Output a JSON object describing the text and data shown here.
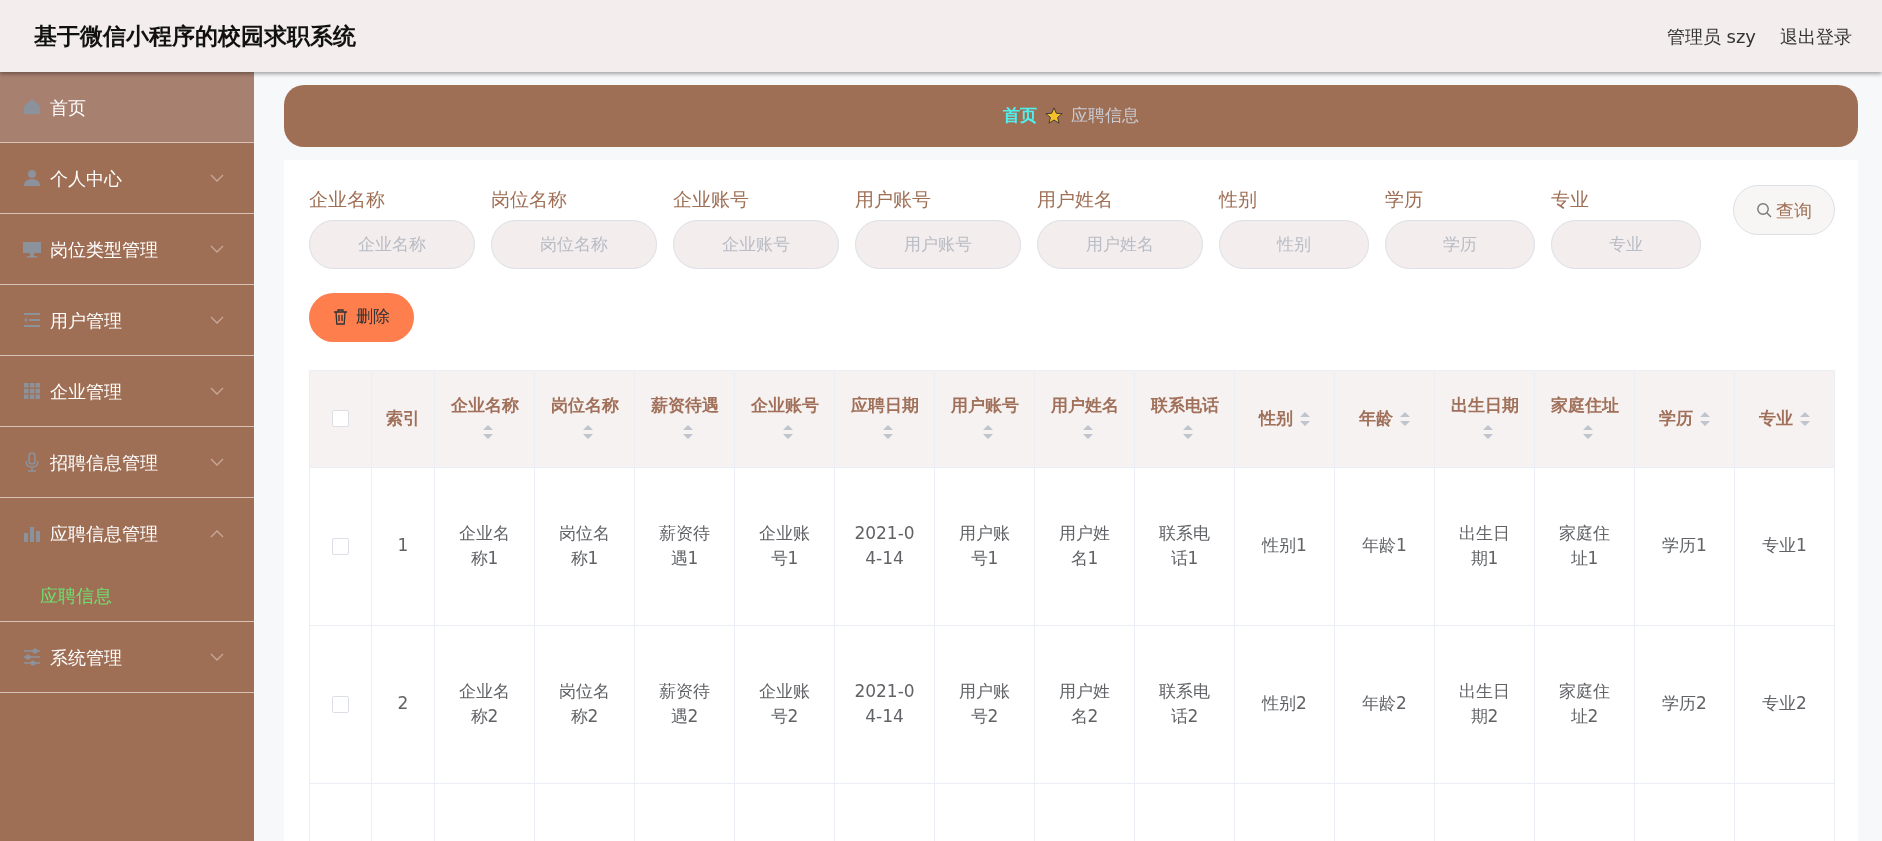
{
  "header": {
    "title": "基于微信小程序的校园求职系统",
    "user": "管理员 szy",
    "logout": "退出登录"
  },
  "sidebar": {
    "items": [
      {
        "label": "首页",
        "kind": "link",
        "selected": true
      },
      {
        "label": "个人中心",
        "kind": "menu",
        "selected": false,
        "expanded": false
      },
      {
        "label": "岗位类型管理",
        "kind": "menu",
        "selected": false,
        "expanded": false
      },
      {
        "label": "用户管理",
        "kind": "menu",
        "selected": false,
        "expanded": false
      },
      {
        "label": "企业管理",
        "kind": "menu",
        "selected": false,
        "expanded": false
      },
      {
        "label": "招聘信息管理",
        "kind": "menu",
        "selected": false,
        "expanded": false
      },
      {
        "label": "应聘信息管理",
        "kind": "menu",
        "selected": false,
        "expanded": true,
        "children": [
          {
            "label": "应聘信息",
            "selected": true
          }
        ]
      },
      {
        "label": "系统管理",
        "kind": "menu",
        "selected": false,
        "expanded": false
      }
    ]
  },
  "breadcrumb": [
    {
      "text": "首页"
    },
    {
      "text": "应聘信息"
    }
  ],
  "filters": [
    {
      "label": "企业名称",
      "placeholder": "企业名称"
    },
    {
      "label": "岗位名称",
      "placeholder": "岗位名称"
    },
    {
      "label": "企业账号",
      "placeholder": "企业账号"
    },
    {
      "label": "用户账号",
      "placeholder": "用户账号"
    },
    {
      "label": "用户姓名",
      "placeholder": "用户姓名"
    },
    {
      "label": "性别",
      "placeholder": "性别"
    },
    {
      "label": "学历",
      "placeholder": "学历"
    },
    {
      "label": "专业",
      "placeholder": "专业"
    }
  ],
  "search_button": "查询",
  "delete_button": "删除",
  "table": {
    "select_all_checked": false,
    "columns": [
      {
        "label": "索引",
        "sortable": false
      },
      {
        "label": "企业名称",
        "sortable": true
      },
      {
        "label": "岗位名称",
        "sortable": true
      },
      {
        "label": "薪资待遇",
        "sortable": true
      },
      {
        "label": "企业账号",
        "sortable": true
      },
      {
        "label": "应聘日期",
        "sortable": true
      },
      {
        "label": "用户账号",
        "sortable": true
      },
      {
        "label": "用户姓名",
        "sortable": true
      },
      {
        "label": "联系电话",
        "sortable": true
      },
      {
        "label": "性别",
        "sortable": true
      },
      {
        "label": "年龄",
        "sortable": true
      },
      {
        "label": "出生日期",
        "sortable": true
      },
      {
        "label": "家庭住址",
        "sortable": true
      },
      {
        "label": "学历",
        "sortable": true
      },
      {
        "label": "专业",
        "sortable": true
      }
    ],
    "rows": [
      {
        "checked": false,
        "cells": [
          "1",
          "企业名称1",
          "岗位名称1",
          "薪资待遇1",
          "企业账号1",
          "2021-04-14",
          "用户账号1",
          "用户姓名1",
          "联系电话1",
          "性别1",
          "年龄1",
          "出生日期1",
          "家庭住址1",
          "学历1",
          "专业1"
        ]
      },
      {
        "checked": false,
        "cells": [
          "2",
          "企业名称2",
          "岗位名称2",
          "薪资待遇2",
          "企业账号2",
          "2021-04-14",
          "用户账号2",
          "用户姓名2",
          "联系电话2",
          "性别2",
          "年龄2",
          "出生日期2",
          "家庭住址2",
          "学历2",
          "专业2"
        ]
      }
    ]
  }
}
